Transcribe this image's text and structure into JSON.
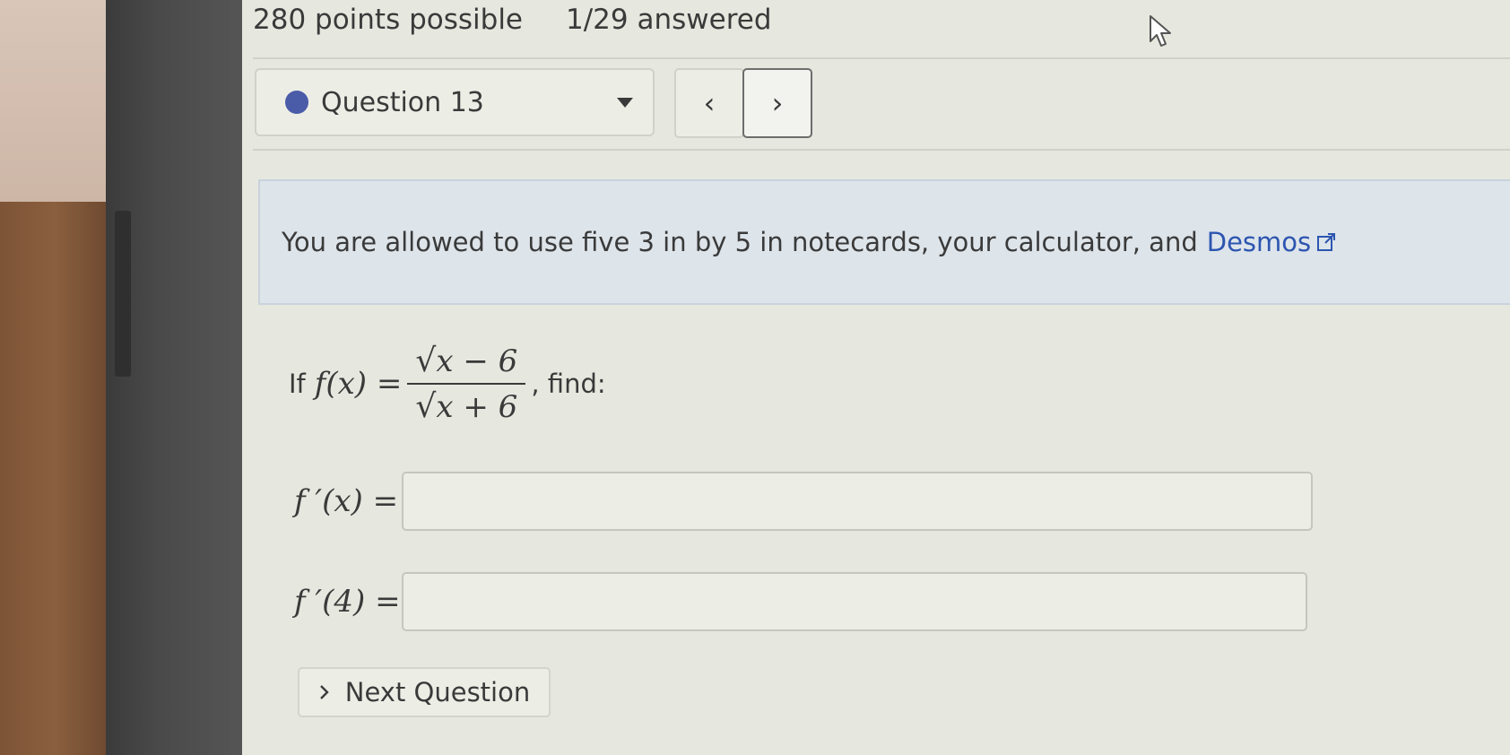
{
  "header": {
    "points_possible": "280 points possible",
    "answered": "1/29 answered"
  },
  "question_nav": {
    "selected": "Question 13",
    "prev_glyph": "‹",
    "next_glyph": "›",
    "status_color": "#4a5ba8"
  },
  "notice": {
    "text": "You are allowed to use five 3 in by 5 in notecards, your calculator, and",
    "link_text": "Desmos",
    "link_color": "#2d55b0",
    "link_icon": "external-link-icon"
  },
  "question": {
    "prefix": "If",
    "function": "f(x) =",
    "numerator": "x − 6",
    "denominator": "x + 6",
    "suffix": ", find:"
  },
  "answers": [
    {
      "label": "f ′(x) =",
      "value": ""
    },
    {
      "label": "f ′(4) =",
      "value": ""
    }
  ],
  "next_button": {
    "label": "Next Question",
    "icon": "chevron-right-icon"
  }
}
